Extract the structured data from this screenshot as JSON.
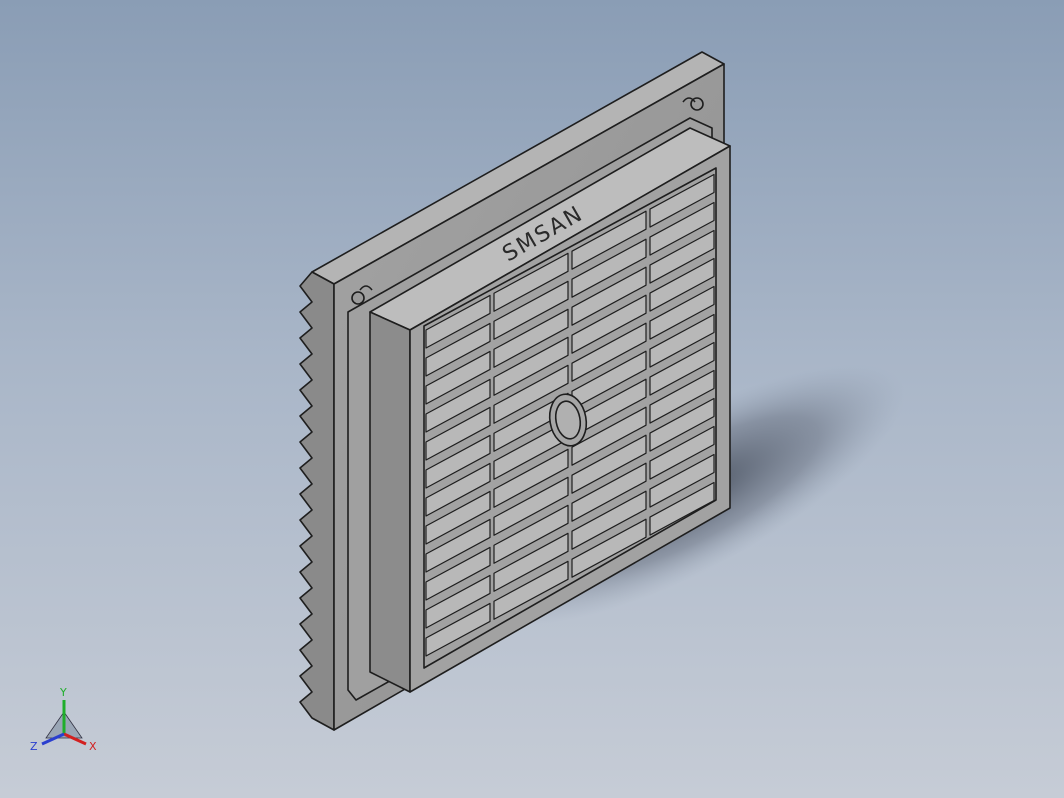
{
  "model": {
    "brand_text": "SMSAN",
    "body_color": "#9a9a9a",
    "edge_color": "#1e1e1e"
  },
  "triad": {
    "x_label": "X",
    "y_label": "Y",
    "z_label": "Z",
    "x_color": "#d22020",
    "y_color": "#1fae2b",
    "z_color": "#2a3fcf"
  }
}
